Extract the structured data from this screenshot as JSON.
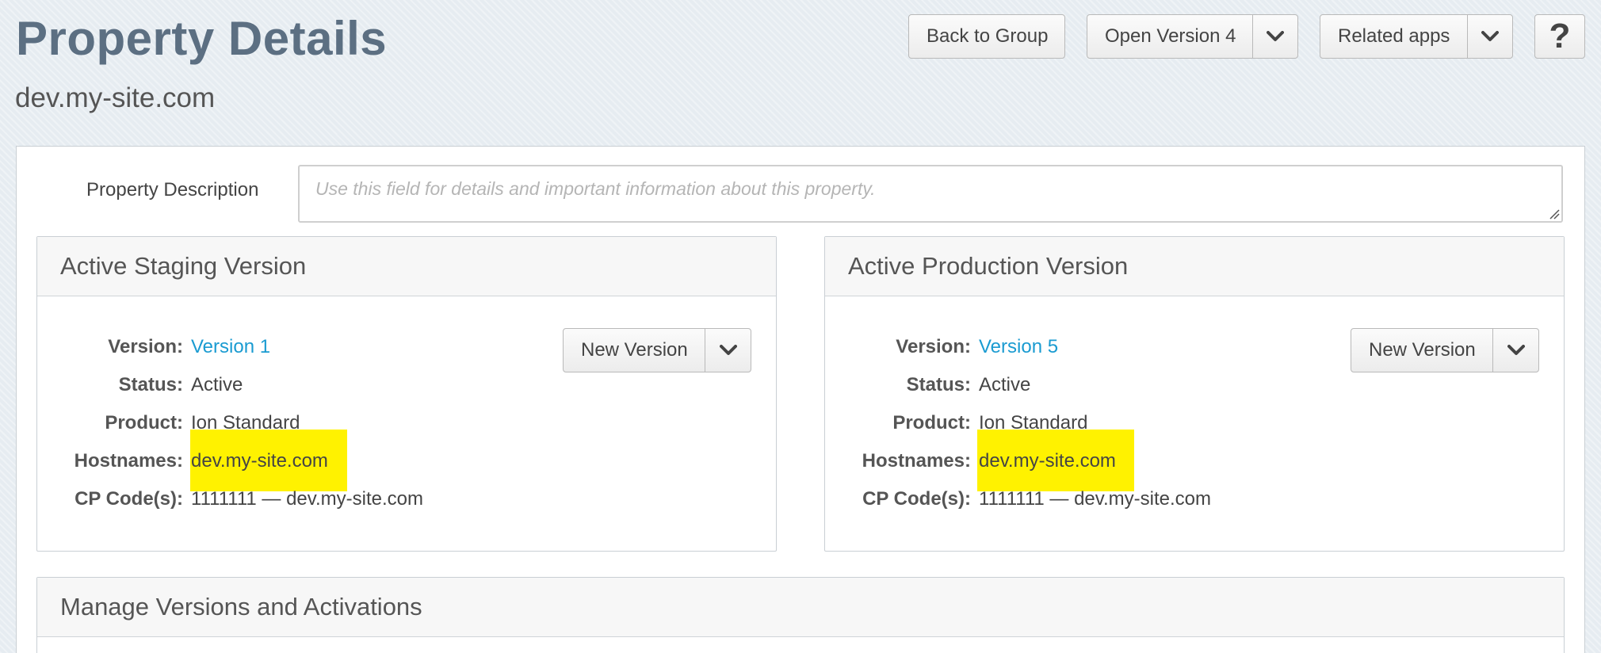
{
  "header": {
    "title": "Property Details",
    "subtitle": "dev.my-site.com",
    "back_button": "Back to Group",
    "open_version_button": "Open Version 4",
    "related_apps_button": "Related apps",
    "help_button": "?"
  },
  "description": {
    "label": "Property Description",
    "value": "",
    "placeholder": "Use this field for details and important information about this property."
  },
  "staging": {
    "title": "Active Staging Version",
    "new_version_button": "New Version",
    "version_label": "Version:",
    "version_value": "Version 1",
    "status_label": "Status:",
    "status_value": "Active",
    "product_label": "Product:",
    "product_value": "Ion Standard",
    "hostnames_label": "Hostnames:",
    "hostnames_value": "dev.my-site.com",
    "cpcode_label": "CP Code(s):",
    "cpcode_value": "1111111 — dev.my-site.com"
  },
  "production": {
    "title": "Active Production Version",
    "new_version_button": "New Version",
    "version_label": "Version:",
    "version_value": "Version 5",
    "status_label": "Status:",
    "status_value": "Active",
    "product_label": "Product:",
    "product_value": "Ion Standard",
    "hostnames_label": "Hostnames:",
    "hostnames_value": "dev.my-site.com",
    "cpcode_label": "CP Code(s):",
    "cpcode_value": "1111111 — dev.my-site.com"
  },
  "manage": {
    "title": "Manage Versions and Activations"
  },
  "icons": {
    "caret": "chevron-down-icon",
    "resize": "resize-grip-icon"
  },
  "colors": {
    "title": "#5c6f82",
    "link": "#1a9bd1",
    "highlight": "#fff200",
    "background": "#e6ecf1"
  }
}
